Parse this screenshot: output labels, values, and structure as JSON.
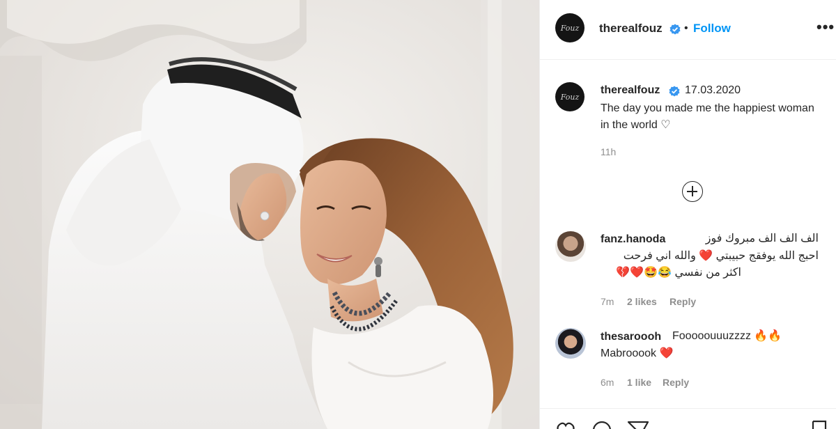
{
  "post": {
    "username": "therealfouz",
    "follow_label": "Follow",
    "separator": "•",
    "more_label": "•••",
    "avatar_initials": "Fouz"
  },
  "caption": {
    "username": "therealfouz",
    "date": "17.03.2020",
    "text": "The day you made me the happiest woman in the world ♡",
    "time": "11h"
  },
  "comments": [
    {
      "username": "fanz.hanoda",
      "line1": "الف الف الف مبروك فوز",
      "line2": "احبج الله يوفقج حبيبتي ❤️ والله اني فرحت",
      "line3": "اكثر من نفسي 😂🤩❤️💔",
      "time": "7m",
      "likes": "2 likes",
      "reply": "Reply"
    },
    {
      "username": "thesaroooh",
      "line1": "Fooooouuuzzzz 🔥🔥",
      "line2": "Mabrooook ❤️",
      "time": "6m",
      "likes": "1 like",
      "reply": "Reply"
    }
  ],
  "icons": {
    "verified": "verified-badge-icon",
    "add_comment": "plus-circle-icon",
    "like": "heart-icon",
    "comment": "comment-icon",
    "share": "share-icon",
    "save": "bookmark-icon"
  },
  "colors": {
    "accent": "#0095f6",
    "text": "#262626",
    "muted": "#8e8e8e",
    "heart": "#ed4956"
  }
}
